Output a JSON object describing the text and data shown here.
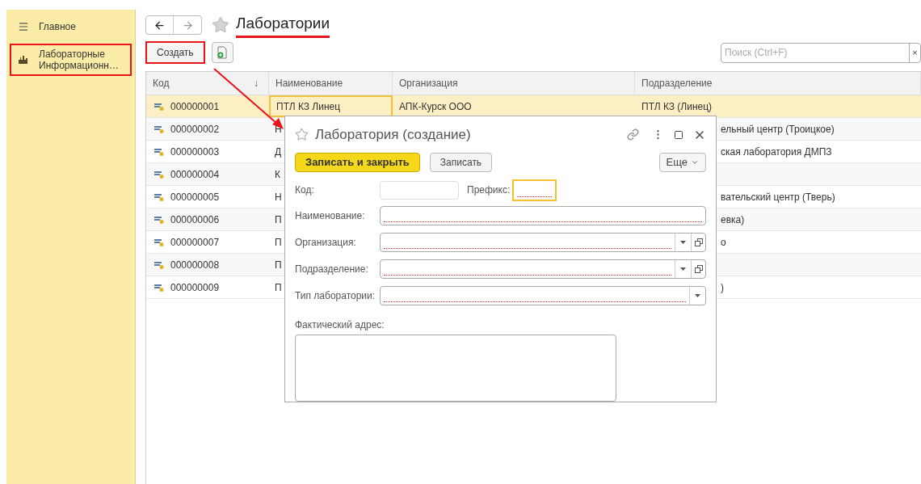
{
  "sidebar": {
    "items": [
      {
        "kind": "menu",
        "label": "Главное",
        "highlighted": false
      },
      {
        "kind": "section",
        "label": "Лабораторные\nИнформационн…",
        "highlighted": true
      }
    ]
  },
  "header": {
    "title": "Лаборатории",
    "underlined": true
  },
  "toolbar": {
    "create_button": {
      "label": "Создать",
      "highlighted": true
    },
    "search": {
      "placeholder": "Поиск (Ctrl+F)",
      "clear": "×"
    }
  },
  "table": {
    "columns": [
      {
        "label": "Код",
        "sort": "↓"
      },
      {
        "label": "Наименование"
      },
      {
        "label": "Организация"
      },
      {
        "label": "Подразделение"
      }
    ],
    "rows": [
      {
        "selected": true,
        "code": "000000001",
        "name": "ПТЛ КЗ Линец",
        "organization": "АПК-Курск ООО",
        "department": "ПТЛ КЗ (Линец)"
      },
      {
        "selected": false,
        "code": "000000002",
        "name": "Н",
        "department": "ельный центр (Троицкое)"
      },
      {
        "selected": false,
        "code": "000000003",
        "name": "Д",
        "department": "ская лаборатория ДМПЗ"
      },
      {
        "selected": false,
        "code": "000000004",
        "name": "К"
      },
      {
        "selected": false,
        "code": "000000005",
        "name": "Н",
        "department": "вательский центр (Тверь)"
      },
      {
        "selected": false,
        "code": "000000006",
        "name": "П",
        "department": "евка)"
      },
      {
        "selected": false,
        "code": "000000007",
        "name": "П",
        "department": "о"
      },
      {
        "selected": false,
        "code": "000000008",
        "name": "П"
      },
      {
        "selected": false,
        "code": "000000009",
        "name": "П",
        "department": ")"
      }
    ]
  },
  "dialog": {
    "title": "Лаборатория (создание)",
    "buttons": [
      {
        "kind": "primary",
        "label": "Записать и закрыть"
      },
      {
        "kind": "secondary",
        "label": "Записать"
      }
    ],
    "more_button": "Еще",
    "code_row": {
      "code_label": "Код:",
      "prefix_label": "Префикс:",
      "prefix_focused": true,
      "prefix_required": true
    },
    "fields": [
      {
        "kind": "text",
        "label": "Наименование:",
        "required": true
      },
      {
        "kind": "select_open",
        "label": "Организация:",
        "required": true
      },
      {
        "kind": "select_open",
        "label": "Подразделение:",
        "required": true
      },
      {
        "kind": "select",
        "label": "Тип лаборатории:",
        "required": true
      },
      {
        "kind": "textarea",
        "label": "Фактический адрес:",
        "required": false
      }
    ]
  }
}
